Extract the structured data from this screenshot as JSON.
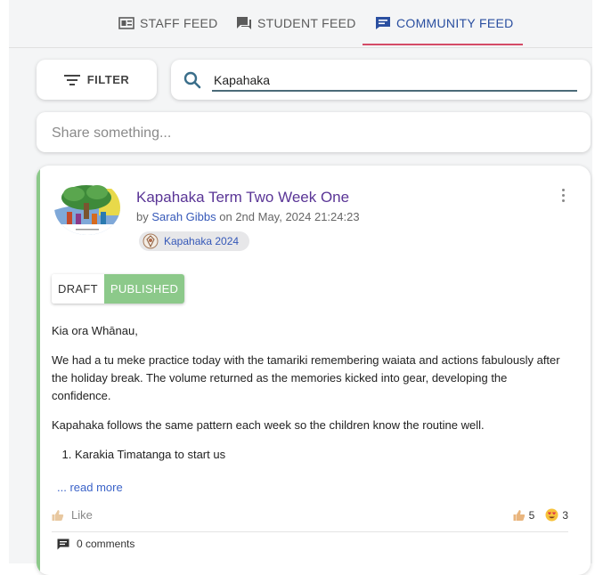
{
  "tabs": {
    "staff": "STAFF FEED",
    "student": "STUDENT FEED",
    "community": "COMMUNITY FEED"
  },
  "toolbar": {
    "filter_label": "FILTER",
    "search_value": "Kapahaka",
    "share_placeholder": "Share something..."
  },
  "post": {
    "title": "Kapahaka Term Two Week One",
    "by": "by",
    "author": "Sarah Gibbs",
    "on": "on 2nd May, 2024 21:24:23",
    "group": "Kapahaka 2024",
    "status_draft": "DRAFT",
    "status_published": "PUBLISHED",
    "paragraphs": [
      "Kia ora Whānau,",
      "We had a tu meke practice today with the tamariki remembering waiata and actions fabulously after the holiday break. The volume returned as the memories kicked into gear, developing the confidence.",
      "Kapahaka follows the same pattern each week so the children know the routine well."
    ],
    "list_items": [
      "Karakia Timatanga to start us"
    ],
    "read_more": "... read more",
    "like_label": "Like",
    "reactions": {
      "like_count": "5",
      "love_count": "3"
    },
    "comments_label": "0 comments"
  },
  "colors": {
    "accent_tab": "#2a4fa0",
    "tab_underline": "#d44a66",
    "published": "#8cc98a",
    "title": "#5a3596",
    "link": "#3558b8"
  },
  "icons": [
    "staff-feed-icon",
    "student-feed-icon",
    "community-feed-icon",
    "filter-icon",
    "search-icon",
    "kebab-menu-icon",
    "group-icon",
    "thumbs-up-icon",
    "heart-eyes-icon",
    "comment-icon"
  ]
}
